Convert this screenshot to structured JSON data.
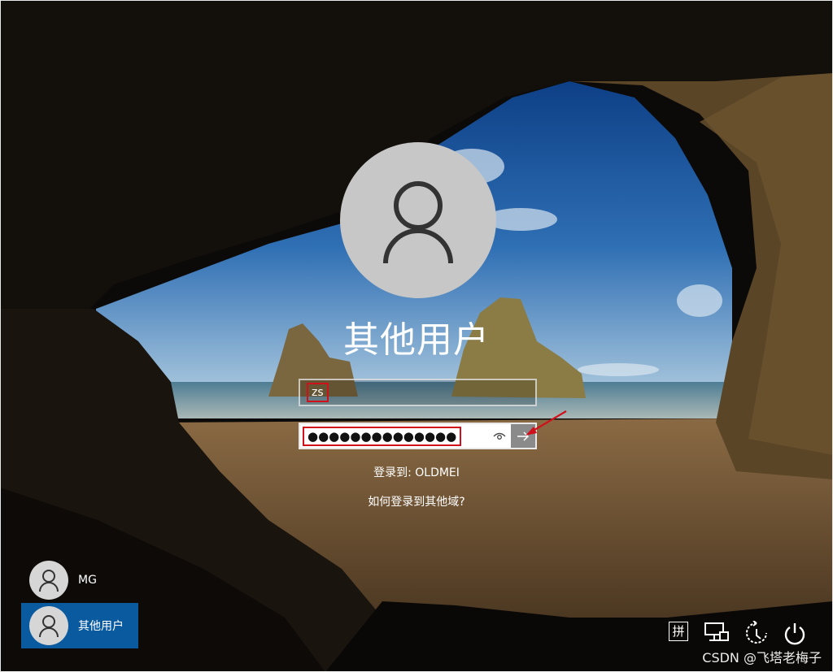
{
  "login": {
    "username": "其他用户",
    "user_value": "zs",
    "password_mask": "●●●●●●●●●●●●●●",
    "sign_in_to": "登录到: OLDMEI",
    "other_domain_link": "如何登录到其他域?"
  },
  "users": [
    {
      "name": "MG",
      "selected": false
    },
    {
      "name": "其他用户",
      "selected": true
    }
  ],
  "tray": {
    "ime_label": "拼",
    "icons": [
      "ime-icon",
      "network-icon",
      "ease-of-access-icon",
      "power-icon"
    ]
  },
  "watermark": "CSDN @飞塔老梅子",
  "colors": {
    "selected_tile": "#0a5aa0",
    "highlight": "#d0101a"
  }
}
